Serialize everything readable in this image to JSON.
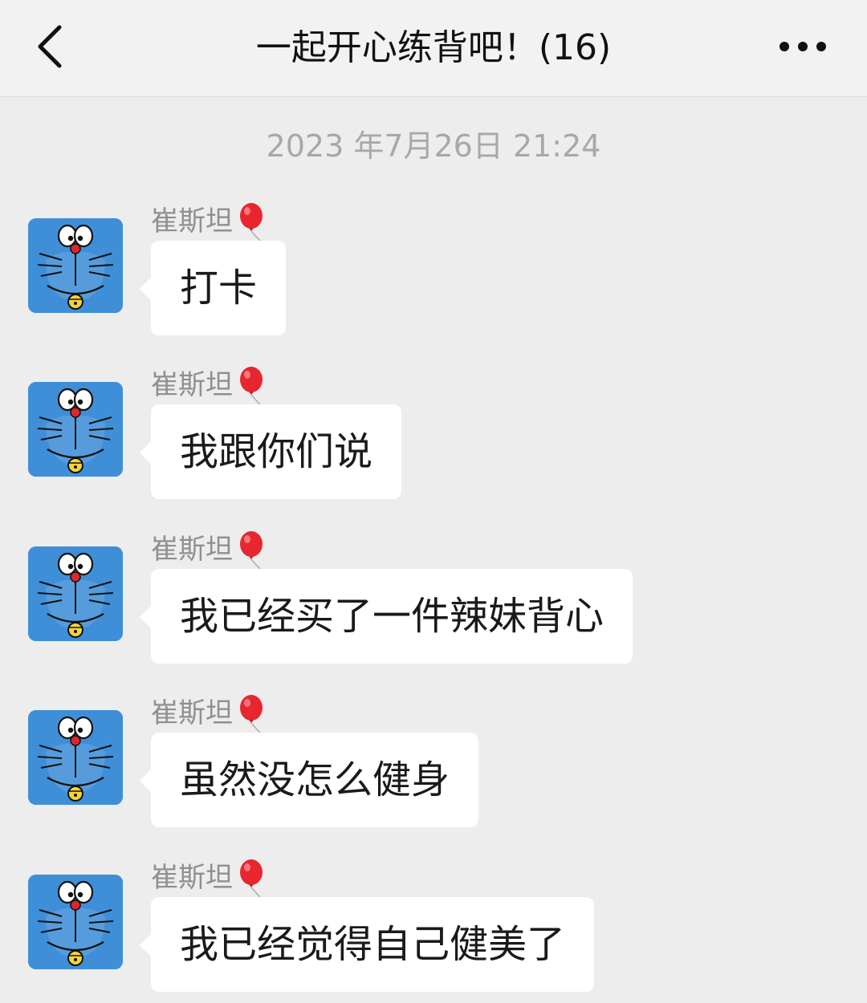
{
  "header": {
    "title": "一起开心练背吧！(16)"
  },
  "timestamp": "2023 年7月26日 21:24",
  "messages": [
    {
      "sender": "崔斯坦",
      "text": "打卡"
    },
    {
      "sender": "崔斯坦",
      "text": "我跟你们说"
    },
    {
      "sender": "崔斯坦",
      "text": "我已经买了一件辣妹背心"
    },
    {
      "sender": "崔斯坦",
      "text": "虽然没怎么健身"
    },
    {
      "sender": "崔斯坦",
      "text": "我已经觉得自己健美了"
    }
  ],
  "icons": {
    "back": "chevron-left-icon",
    "more": "more-dots-icon",
    "avatar": "doraemon-avatar",
    "sender_badge": "red-balloon-emoji"
  },
  "colors": {
    "background": "#ededed",
    "header": "#f2f2f2",
    "bubble": "#ffffff",
    "avatar_blue": "#3f8fd8",
    "balloon_red": "#e8262f"
  }
}
